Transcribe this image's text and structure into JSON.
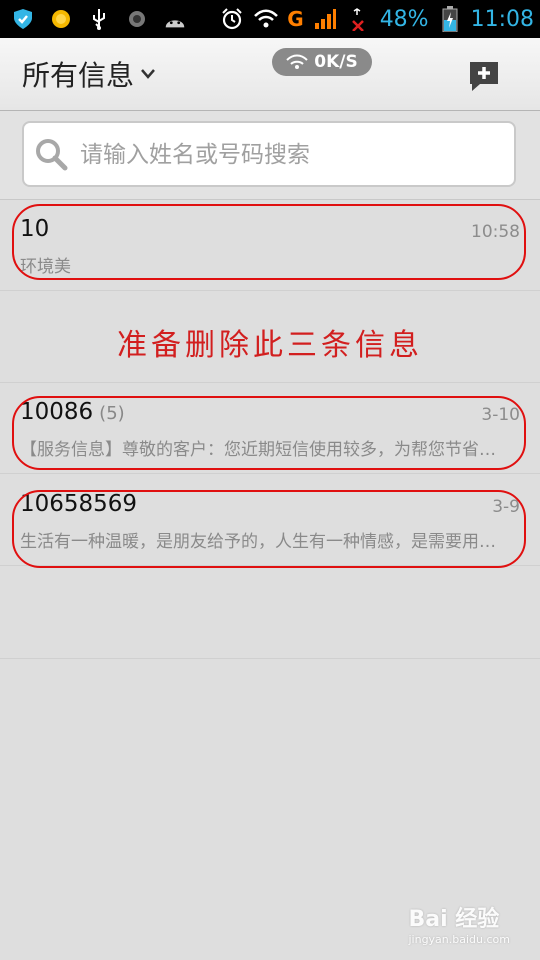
{
  "status_bar": {
    "battery": "48%",
    "time": "11:08",
    "network_letter": "G"
  },
  "header": {
    "title": "所有信息",
    "speed": "0K/S"
  },
  "search": {
    "placeholder": "请输入姓名或号码搜索"
  },
  "conversations": [
    {
      "name": "10",
      "count": "",
      "time": "10:58",
      "preview": "环境美"
    },
    {
      "name": "10086",
      "count": "(5)",
      "time": "3-10",
      "preview": "【服务信息】尊敬的客户：您近期短信使用较多，为帮您节省…"
    },
    {
      "name": "10658569",
      "count": "",
      "time": "3-9",
      "preview": "生活有一种温暖，是朋友给予的，人生有一种情感，是需要用…"
    }
  ],
  "annotation": "准备删除此三条信息",
  "watermark": {
    "brand": "Bai 经验",
    "url": "jingyan.baidu.com"
  },
  "colors": {
    "accent": "#33b5e5",
    "highlight": "#e01010",
    "annotation": "#d21f1f"
  }
}
